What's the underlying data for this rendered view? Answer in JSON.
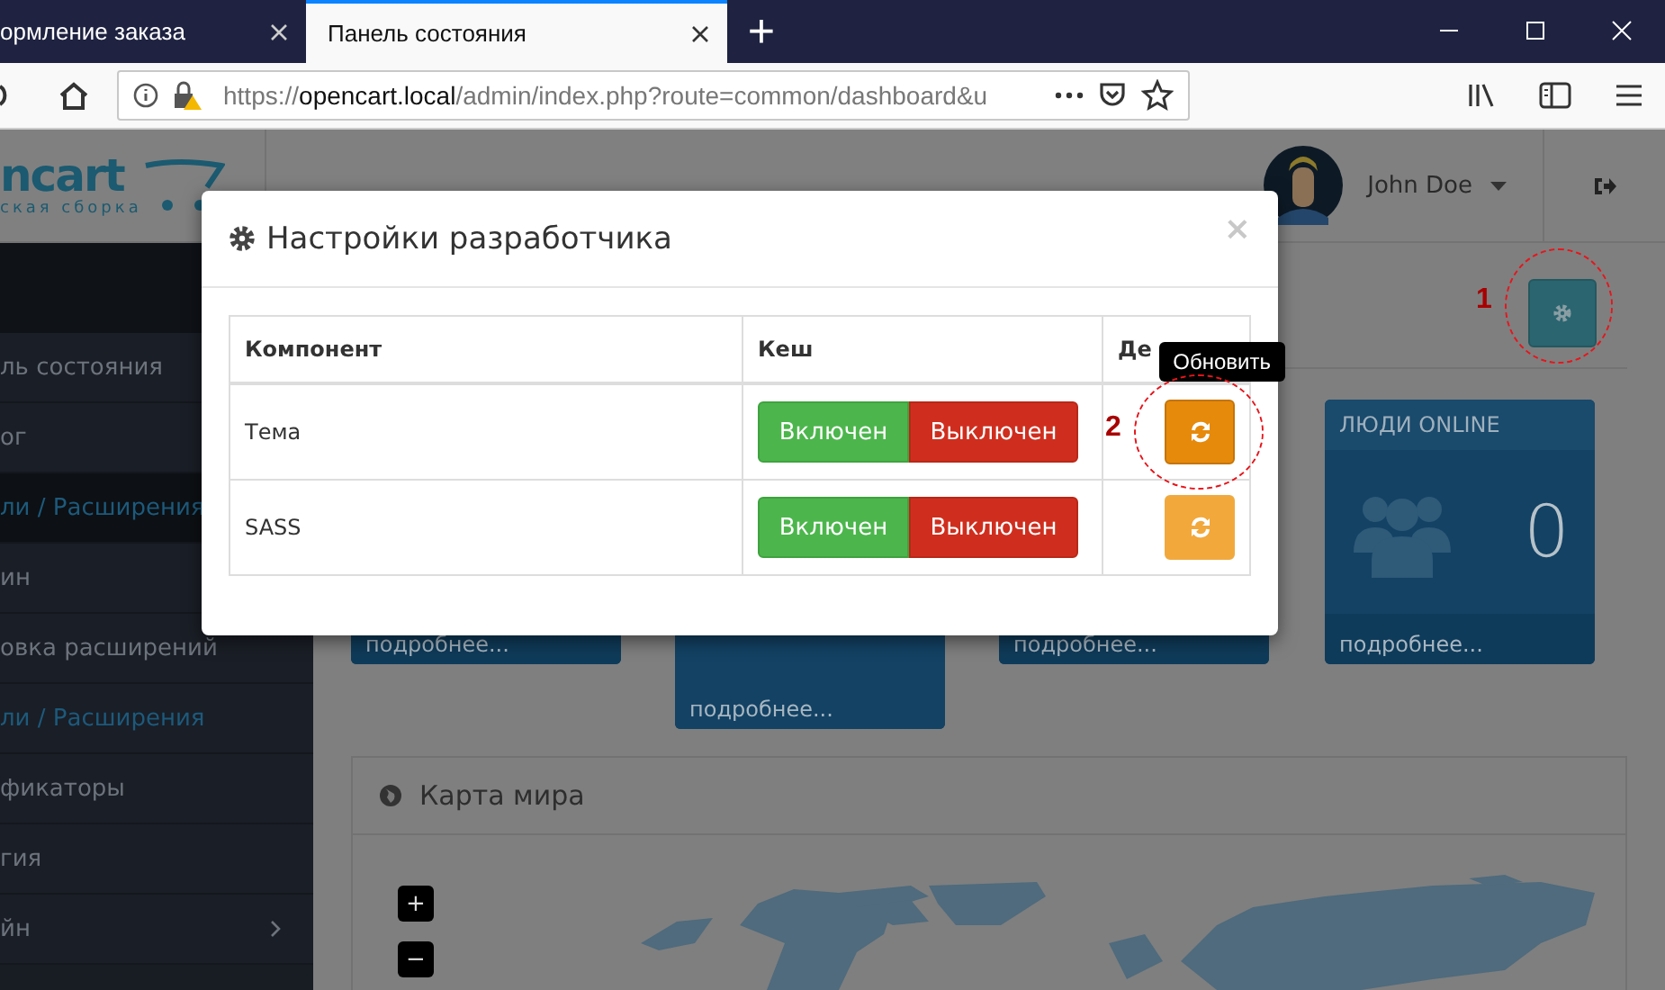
{
  "browser": {
    "tabs": [
      {
        "title": "ормление заказа",
        "selected": false
      },
      {
        "title": "Панель состояния",
        "selected": true
      }
    ],
    "new_tab": "+",
    "url": {
      "scheme": "https://",
      "host": "opencart.local",
      "path": "/admin/index.php?route=common/dashboard&u"
    }
  },
  "header": {
    "logo": {
      "name": "ncart",
      "subtitle": "ская сборка"
    },
    "user": "John Doe"
  },
  "sidebar": {
    "items": [
      {
        "label": "ль состояния",
        "active": false,
        "selected": false,
        "expandable": false
      },
      {
        "label": "ог",
        "active": false,
        "selected": false,
        "expandable": false
      },
      {
        "label": "ли / Расширения",
        "active": true,
        "selected": true,
        "expandable": false
      },
      {
        "label": "ин",
        "active": false,
        "selected": false,
        "expandable": false
      },
      {
        "label": "овка расширений",
        "active": false,
        "selected": false,
        "expandable": false
      },
      {
        "label": "ли / Расширения",
        "active": true,
        "selected": false,
        "expandable": false
      },
      {
        "label": "фикаторы",
        "active": false,
        "selected": false,
        "expandable": false
      },
      {
        "label": "гия",
        "active": false,
        "selected": false,
        "expandable": false
      },
      {
        "label": "йн",
        "active": false,
        "selected": false,
        "expandable": true
      }
    ]
  },
  "tiles": [
    {
      "footer": "подробнее...",
      "expanded": false
    },
    {
      "footer": "подробнее...",
      "expanded": true
    },
    {
      "footer": "подробнее...",
      "expanded": false
    },
    {
      "title": "ЛЮДИ ONLINE",
      "value": "0",
      "footer": "подробнее...",
      "expanded": false
    }
  ],
  "map_panel": {
    "title": "Карта мира",
    "zoom_in": "+",
    "zoom_out": "−"
  },
  "modal": {
    "title": "Настройки разработчика",
    "close": "×",
    "tooltip": "Обновить",
    "columns": [
      "Компонент",
      "Кеш",
      "Де"
    ],
    "rows": [
      {
        "component": "Тема",
        "cache_on": "Включен",
        "cache_off": "Выключен",
        "hovered": true
      },
      {
        "component": "SASS",
        "cache_on": "Включен",
        "cache_off": "Выключен",
        "hovered": false
      }
    ]
  },
  "annotations": [
    "1",
    "2"
  ]
}
